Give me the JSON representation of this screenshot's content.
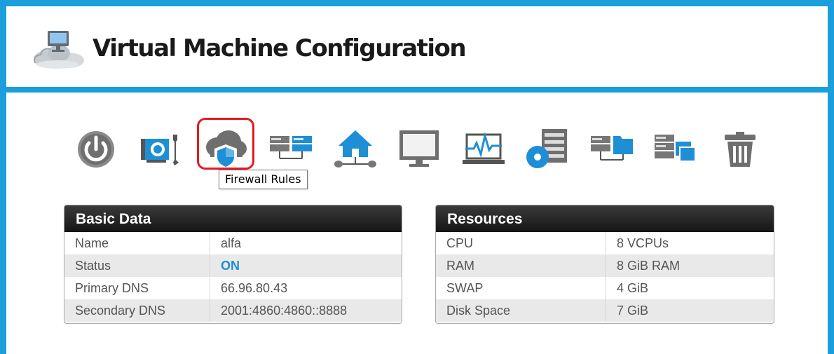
{
  "header": {
    "title": "Virtual Machine Configuration",
    "icon": "cloud-computer-icon"
  },
  "toolbar": {
    "items": [
      {
        "name": "power",
        "icon": "power-icon"
      },
      {
        "name": "hardware-settings",
        "icon": "network-card-wrench-icon"
      },
      {
        "name": "firewall-rules",
        "icon": "cloud-shield-icon",
        "selected": true
      },
      {
        "name": "network-servers",
        "icon": "servers-network-icon"
      },
      {
        "name": "home-network",
        "icon": "home-network-icon"
      },
      {
        "name": "console",
        "icon": "monitor-icon"
      },
      {
        "name": "monitoring",
        "icon": "laptop-pulse-icon"
      },
      {
        "name": "disk-media",
        "icon": "disk-server-icon"
      },
      {
        "name": "file-transfer",
        "icon": "server-folder-icon"
      },
      {
        "name": "snapshots",
        "icon": "server-copy-icon"
      },
      {
        "name": "delete",
        "icon": "trash-icon"
      }
    ],
    "tooltip": "Firewall Rules"
  },
  "basic_data": {
    "title": "Basic Data",
    "rows": [
      {
        "label": "Name",
        "value": "alfa"
      },
      {
        "label": "Status",
        "value": "ON"
      },
      {
        "label": "Primary DNS",
        "value": "66.96.80.43"
      },
      {
        "label": "Secondary DNS",
        "value": "2001:4860:4860::8888"
      }
    ]
  },
  "resources": {
    "title": "Resources",
    "rows": [
      {
        "label": "CPU",
        "value": "8 VCPUs"
      },
      {
        "label": "RAM",
        "value": "8 GiB RAM"
      },
      {
        "label": "SWAP",
        "value": "4 GiB"
      },
      {
        "label": "Disk Space",
        "value": "7 GiB"
      }
    ]
  },
  "colors": {
    "frame": "#1a9fdc",
    "accent": "#1e8fd4",
    "highlight": "#e31b23",
    "icon_gray": "#777777"
  }
}
